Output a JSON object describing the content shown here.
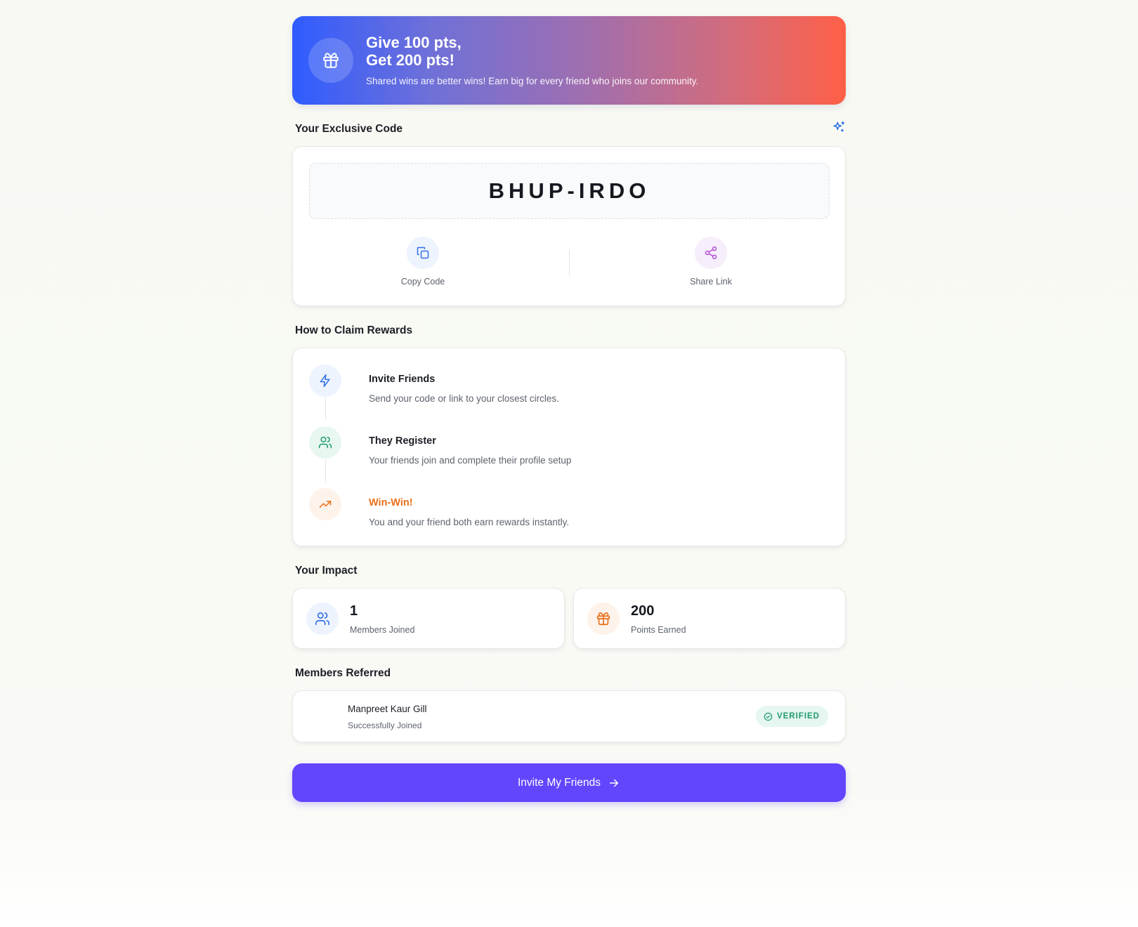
{
  "banner": {
    "title_line1": "Give 100 pts,",
    "title_line2": "Get 200 pts!",
    "subtitle": "Shared wins are better wins! Earn big for every friend who joins our community.",
    "icon": "gift-icon"
  },
  "code_section": {
    "heading": "Your Exclusive Code",
    "code": "BHUP-IRDO",
    "copy_label": "Copy Code",
    "share_label": "Share Link"
  },
  "how_section": {
    "heading": "How to Claim Rewards",
    "steps": [
      {
        "title": "Invite Friends",
        "desc": "Send your code or link to your closest circles.",
        "icon": "lightning-icon"
      },
      {
        "title": "They Register",
        "desc": "Your friends join and complete their profile setup",
        "icon": "users-icon"
      },
      {
        "title": "Win-Win!",
        "desc": "You and your friend both earn rewards instantly.",
        "icon": "trending-up-icon"
      }
    ]
  },
  "impact_section": {
    "heading": "Your Impact",
    "members_value": "1",
    "members_label": "Members Joined",
    "points_value": "200",
    "points_label": "Points Earned"
  },
  "members_section": {
    "heading": "Members Referred",
    "items": [
      {
        "name": "Manpreet Kaur Gill",
        "status": "Successfully Joined",
        "badge": "VERIFIED"
      }
    ]
  },
  "cta": {
    "label": "Invite My Friends"
  },
  "colors": {
    "accent": "#6246fe",
    "blue": "#2f6fe4",
    "green": "#1f9b6e",
    "orange": "#e8701c",
    "purple": "#b34fd1"
  }
}
